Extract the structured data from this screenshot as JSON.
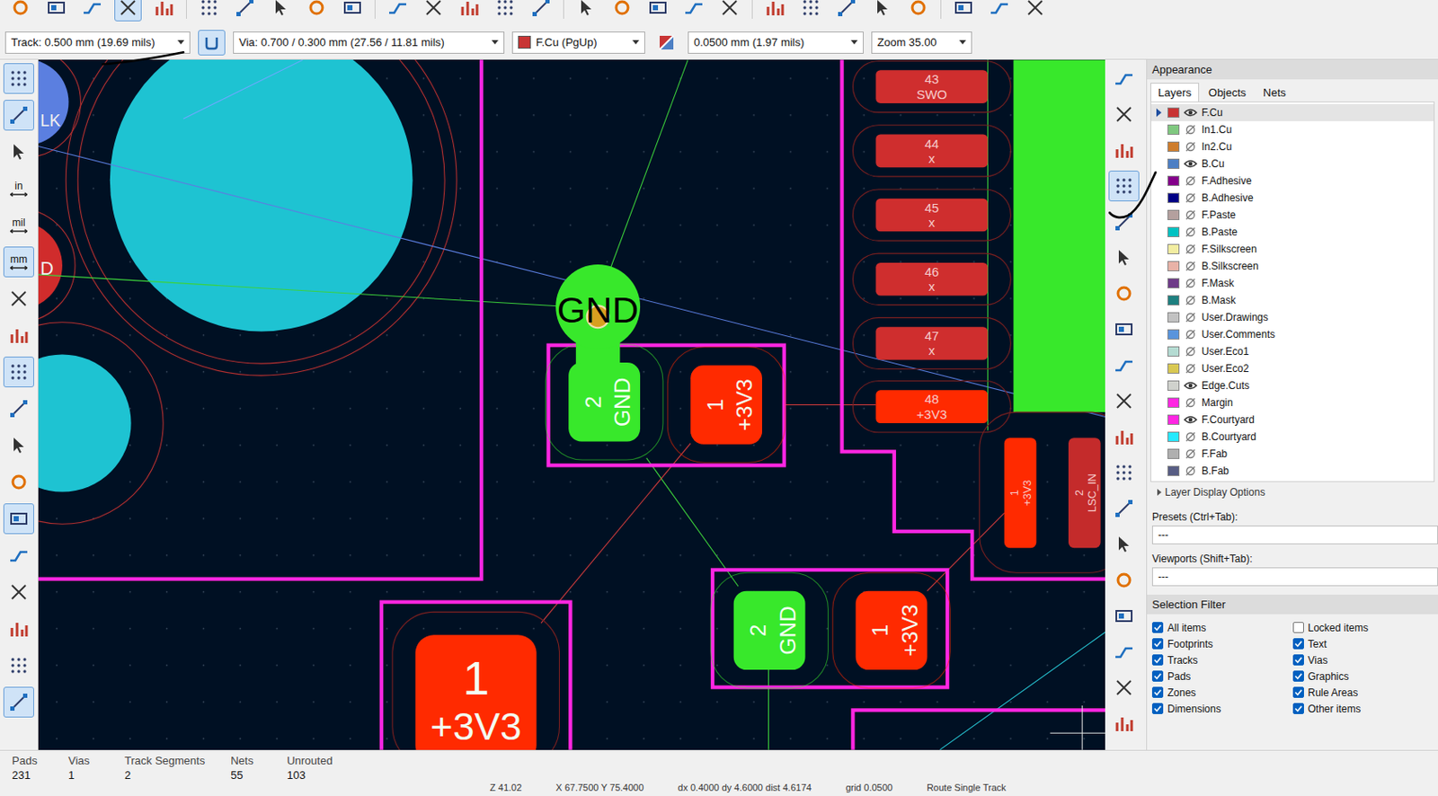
{
  "top_toolbar": [
    {
      "selected": false
    },
    {
      "selected": false
    },
    {
      "selected": false
    },
    {
      "selected": true
    },
    {
      "selected": false
    },
    {
      "selected": false
    },
    {
      "selected": false
    },
    {
      "selected": false
    },
    {
      "selected": false
    },
    {
      "selected": false
    },
    {
      "selected": false
    },
    {
      "selected": false
    },
    {
      "selected": false
    },
    {
      "selected": false
    },
    {
      "selected": false
    },
    {
      "selected": false
    },
    {
      "selected": false
    },
    {
      "selected": false
    },
    {
      "selected": false
    },
    {
      "selected": false
    },
    {
      "selected": false
    },
    {
      "selected": false
    },
    {
      "selected": false
    },
    {
      "selected": false
    },
    {
      "selected": false
    },
    {
      "selected": false
    },
    {
      "selected": false
    },
    {
      "selected": false
    }
  ],
  "options_bar": {
    "track": "Track: 0.500 mm (19.69 mils)",
    "track_button_selected": true,
    "via": "Via: 0.700 / 0.300 mm (27.56 / 11.81 mils)",
    "layer": "F.Cu (PgUp)",
    "grid": "0.0500 mm (1.97 mils)",
    "zoom": "Zoom 35.00"
  },
  "left_toolbar": [
    {
      "selected": true
    },
    {
      "selected": true
    },
    {
      "selected": false
    },
    {
      "label": "in",
      "selected": false
    },
    {
      "label": "mil",
      "selected": false
    },
    {
      "label": "mm",
      "selected": true
    },
    {
      "selected": false
    },
    {
      "selected": false
    },
    {
      "selected": true
    },
    {
      "selected": false
    },
    {
      "selected": false
    },
    {
      "selected": false
    },
    {
      "selected": true
    },
    {
      "selected": false
    },
    {
      "selected": false
    },
    {
      "selected": false
    },
    {
      "selected": false
    },
    {
      "selected": true
    }
  ],
  "right_toolbar": [
    {
      "selected": false
    },
    {
      "selected": false
    },
    {
      "selected": false
    },
    {
      "selected": true
    },
    {
      "selected": false
    },
    {
      "selected": false
    },
    {
      "selected": false
    },
    {
      "selected": false
    },
    {
      "selected": false
    },
    {
      "selected": false
    },
    {
      "selected": false
    },
    {
      "selected": false
    },
    {
      "selected": false
    },
    {
      "selected": false
    },
    {
      "selected": false
    },
    {
      "selected": false
    },
    {
      "selected": false
    },
    {
      "selected": false
    },
    {
      "selected": false
    }
  ],
  "canvas": {
    "edge_pads": [
      "LK",
      "D"
    ],
    "via": {
      "net": "GND"
    },
    "pin_column": [
      {
        "number": "43",
        "net": "SWO",
        "color": "#cf2e2e"
      },
      {
        "number": "44",
        "net": "x",
        "color": "#cf2e2e"
      },
      {
        "number": "45",
        "net": "x",
        "color": "#cf2e2e"
      },
      {
        "number": "46",
        "net": "x",
        "color": "#cf2e2e"
      },
      {
        "number": "47",
        "net": "x",
        "color": "#cf2e2e"
      },
      {
        "number": "48",
        "net": "+3V3",
        "color": "#ff2a00"
      }
    ],
    "side_pads": [
      {
        "number": "1",
        "net": "+3V3"
      },
      {
        "number": "2",
        "net": "LSC_IN"
      }
    ],
    "footprints": [
      {
        "pads": [
          {
            "number": "2",
            "net": "GND",
            "color": "#38e82b"
          },
          {
            "number": "1",
            "net": "+3V3",
            "color": "#ff2a00"
          }
        ]
      },
      {
        "pads": [
          {
            "number": "2",
            "net": "GND",
            "color": "#38e82b"
          },
          {
            "number": "1",
            "net": "+3V3",
            "color": "#ff2a00"
          }
        ]
      }
    ],
    "big_pad": {
      "number": "1",
      "net": "+3V3"
    }
  },
  "appearance": {
    "title": "Appearance",
    "tabs": [
      {
        "label": "Layers",
        "selected": true
      },
      {
        "label": "Objects",
        "selected": false
      },
      {
        "label": "Nets",
        "selected": false
      }
    ],
    "layers": [
      {
        "name": "F.Cu",
        "color": "#c83434",
        "visible": true,
        "selected": true
      },
      {
        "name": "In1.Cu",
        "color": "#7fc87f",
        "visible": false,
        "selected": false
      },
      {
        "name": "In2.Cu",
        "color": "#ce7d2c",
        "visible": false,
        "selected": false
      },
      {
        "name": "B.Cu",
        "color": "#4d7fc4",
        "visible": true,
        "selected": false
      },
      {
        "name": "F.Adhesive",
        "color": "#84008a",
        "visible": false,
        "selected": false
      },
      {
        "name": "B.Adhesive",
        "color": "#000084",
        "visible": false,
        "selected": false
      },
      {
        "name": "F.Paste",
        "color": "#b4a09e",
        "visible": false,
        "selected": false
      },
      {
        "name": "B.Paste",
        "color": "#00c2c2",
        "visible": false,
        "selected": false
      },
      {
        "name": "F.Silkscreen",
        "color": "#f2eda1",
        "visible": false,
        "selected": false
      },
      {
        "name": "B.Silkscreen",
        "color": "#e8b2a7",
        "visible": false,
        "selected": false
      },
      {
        "name": "F.Mask",
        "color": "#6e3b88",
        "visible": false,
        "selected": false
      },
      {
        "name": "B.Mask",
        "color": "#1e8080",
        "visible": false,
        "selected": false
      },
      {
        "name": "User.Drawings",
        "color": "#c2c2c2",
        "visible": false,
        "selected": false
      },
      {
        "name": "User.Comments",
        "color": "#5994dc",
        "visible": false,
        "selected": false
      },
      {
        "name": "User.Eco1",
        "color": "#b4dbd2",
        "visible": false,
        "selected": false
      },
      {
        "name": "User.Eco2",
        "color": "#d8c852",
        "visible": false,
        "selected": false
      },
      {
        "name": "Edge.Cuts",
        "color": "#d0d2cd",
        "visible": true,
        "selected": false
      },
      {
        "name": "Margin",
        "color": "#ff26e2",
        "visible": false,
        "selected": false
      },
      {
        "name": "F.Courtyard",
        "color": "#ff26e2",
        "visible": true,
        "selected": false
      },
      {
        "name": "B.Courtyard",
        "color": "#26e9ff",
        "visible": false,
        "selected": false
      },
      {
        "name": "F.Fab",
        "color": "#afafaf",
        "visible": false,
        "selected": false
      },
      {
        "name": "B.Fab",
        "color": "#585d84",
        "visible": false,
        "selected": false
      }
    ],
    "display_options": "Layer Display Options",
    "presets_label": "Presets (Ctrl+Tab):",
    "presets_value": "---",
    "viewports_label": "Viewports (Shift+Tab):",
    "viewports_value": "---"
  },
  "selection_filter": {
    "title": "Selection Filter",
    "items": [
      {
        "label": "All items",
        "checked": true
      },
      {
        "label": "Locked items",
        "checked": false
      },
      {
        "label": "Footprints",
        "checked": true
      },
      {
        "label": "Text",
        "checked": true
      },
      {
        "label": "Tracks",
        "checked": true
      },
      {
        "label": "Vias",
        "checked": true
      },
      {
        "label": "Pads",
        "checked": true
      },
      {
        "label": "Graphics",
        "checked": true
      },
      {
        "label": "Zones",
        "checked": true
      },
      {
        "label": "Rule Areas",
        "checked": true
      },
      {
        "label": "Dimensions",
        "checked": true
      },
      {
        "label": "Other items",
        "checked": true
      }
    ]
  },
  "status_bar": {
    "stats": [
      {
        "label": "Pads",
        "value": "231"
      },
      {
        "label": "Vias",
        "value": "1"
      },
      {
        "label": "Track Segments",
        "value": "2"
      },
      {
        "label": "Nets",
        "value": "55"
      },
      {
        "label": "Unrouted",
        "value": "103"
      }
    ],
    "info": [
      "Z 41.02",
      "X 67.7500  Y 75.4000",
      "dx 0.4000  dy 4.6000  dist 4.6174",
      "grid 0.0500",
      "Route Single Track"
    ]
  }
}
